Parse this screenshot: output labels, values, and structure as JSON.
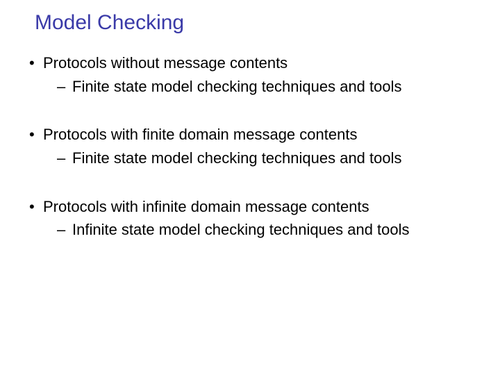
{
  "title": "Model Checking",
  "bullets": [
    {
      "text": "Protocols without message contents",
      "sub": [
        {
          "text": "Finite state model checking techniques and tools"
        }
      ]
    },
    {
      "text": "Protocols with finite domain message contents",
      "sub": [
        {
          "text": "Finite state model checking techniques and tools"
        }
      ]
    },
    {
      "text": "Protocols with infinite domain message contents",
      "sub": [
        {
          "text": "Infinite state model checking techniques and tools"
        }
      ]
    }
  ]
}
